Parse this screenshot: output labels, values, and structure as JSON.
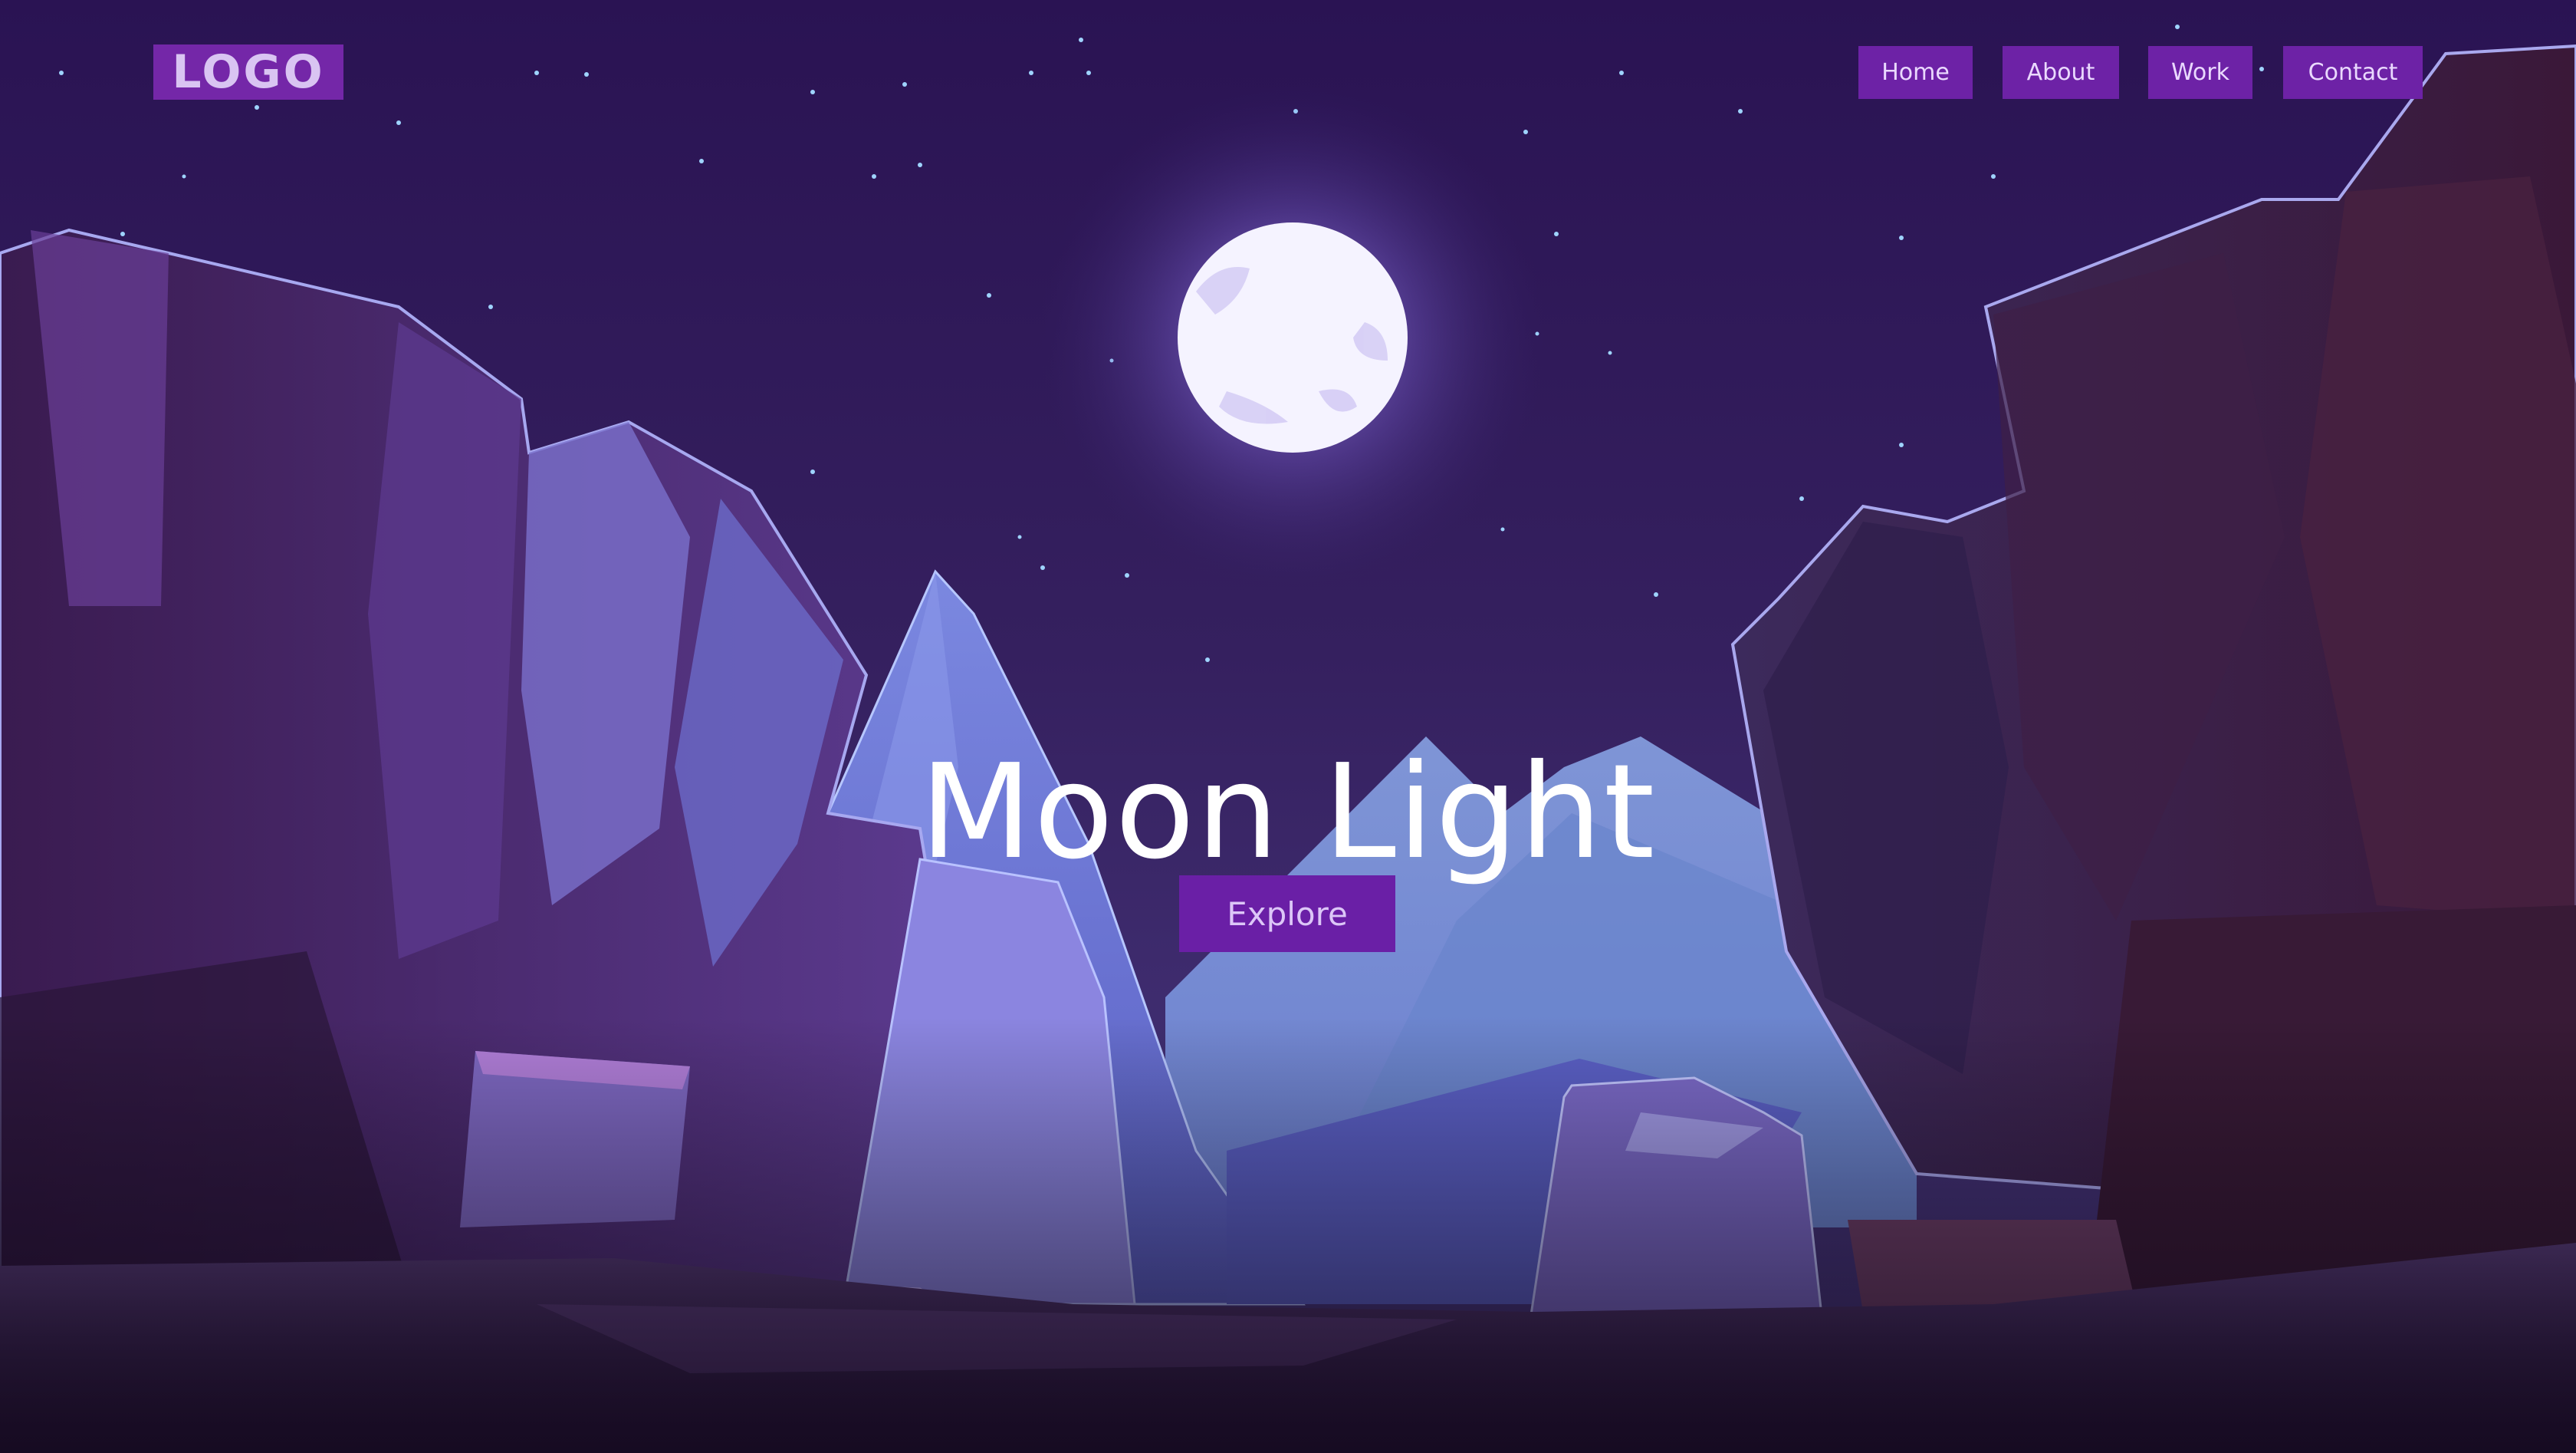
{
  "header": {
    "logo_text": "LOGO",
    "nav": [
      {
        "label": "Home"
      },
      {
        "label": "About"
      },
      {
        "label": "Work"
      },
      {
        "label": "Contact"
      }
    ]
  },
  "hero": {
    "title": "Moon Light",
    "cta_label": "Explore"
  },
  "colors": {
    "sky_top": "#2b1456",
    "sky_bottom": "#40306f",
    "accent_purple": "#6d22a6",
    "moon": "#f4f1ff"
  }
}
